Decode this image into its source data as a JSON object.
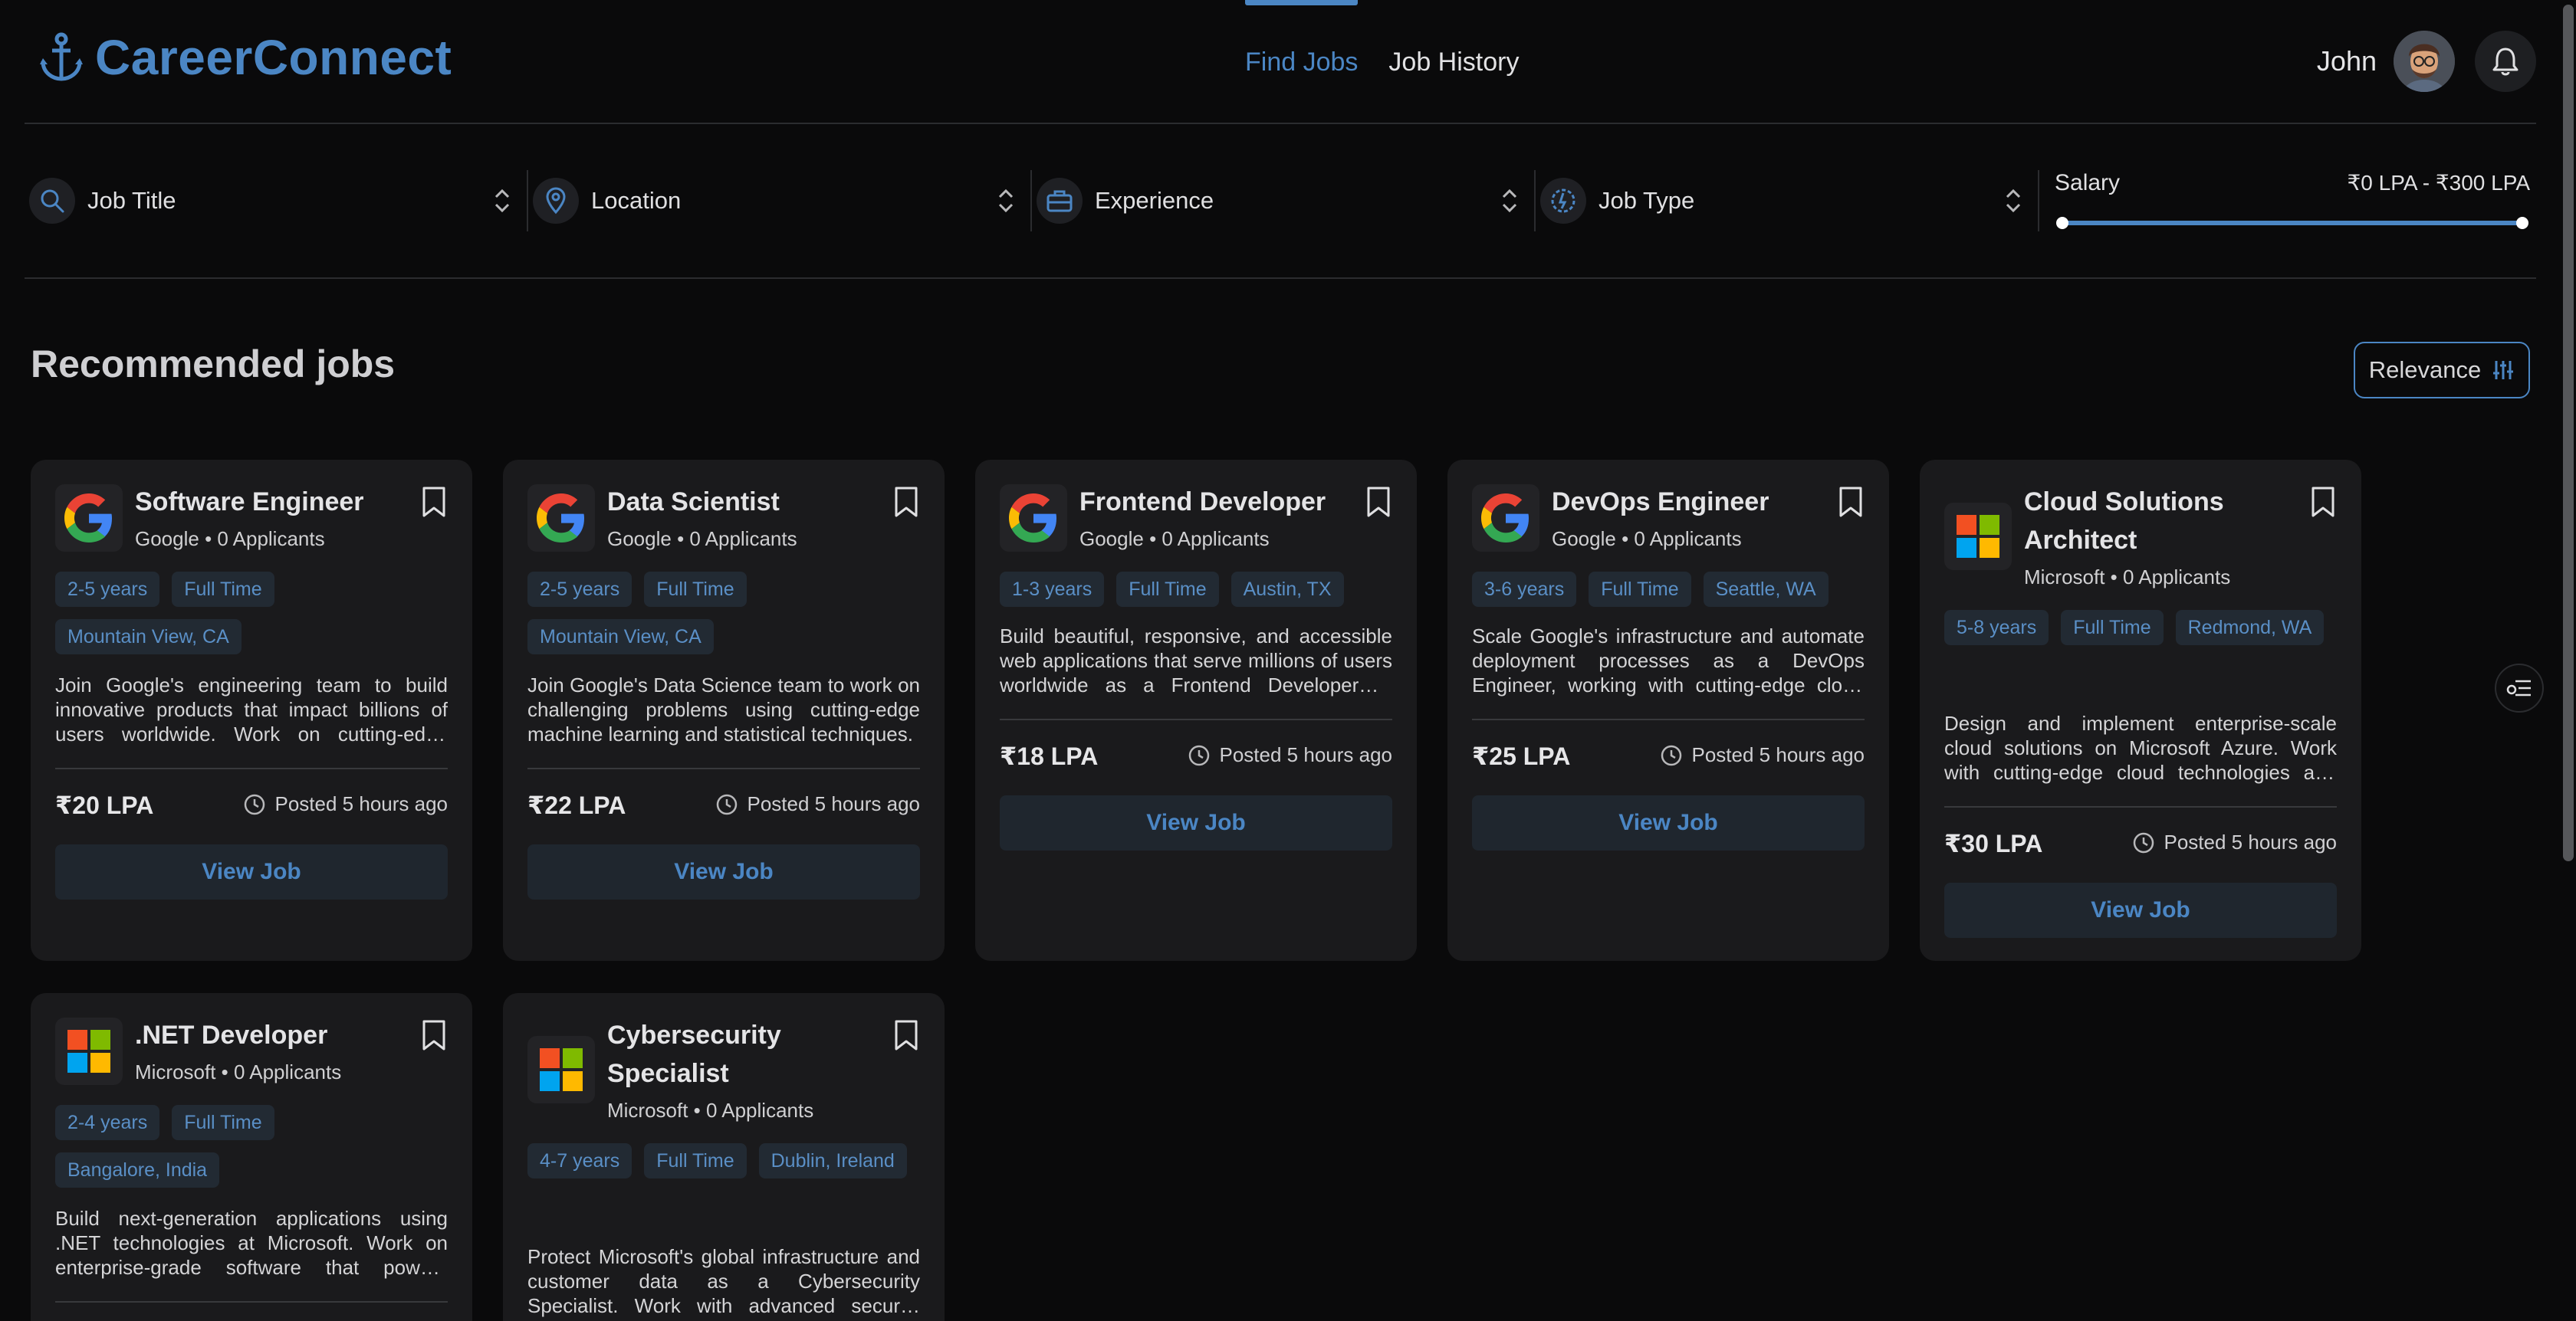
{
  "header": {
    "brand": "CareerConnect",
    "nav": [
      {
        "label": "Find Jobs",
        "active": true
      },
      {
        "label": "Job History",
        "active": false
      }
    ],
    "user_name": "John"
  },
  "filters": {
    "job_title": "Job Title",
    "location": "Location",
    "experience": "Experience",
    "job_type": "Job Type",
    "salary_label": "Salary",
    "salary_range": "₹0 LPA - ₹300 LPA"
  },
  "section": {
    "title": "Recommended jobs",
    "sort_label": "Relevance"
  },
  "jobs": [
    {
      "title": "Software Engineer",
      "company_line": "Google • 0 Applicants",
      "logo": "google-logo",
      "tags": [
        "2-5 years",
        "Full Time",
        "Mountain View, CA"
      ],
      "description": "Join Google's engineering team to build innovative products that impact billions of users worldwide. Work on cutting-edge technologies and scalable systems.",
      "salary": "₹20 LPA",
      "posted": "Posted 5 hours ago",
      "button": "View Job"
    },
    {
      "title": "Data Scientist",
      "company_line": "Google • 0 Applicants",
      "logo": "google-logo",
      "tags": [
        "2-5 years",
        "Full Time",
        "Mountain View, CA"
      ],
      "description": "Join Google's Data Science team to work on challenging problems using cutting-edge machine learning and statistical techniques.",
      "salary": "₹22 LPA",
      "posted": "Posted 5 hours ago",
      "button": "View Job"
    },
    {
      "title": "Frontend Developer",
      "company_line": "Google • 0 Applicants",
      "logo": "google-logo",
      "tags": [
        "1-3 years",
        "Full Time",
        "Austin, TX"
      ],
      "description": "Build beautiful, responsive, and accessible web applications that serve millions of users worldwide as a Frontend Developer at Google.",
      "salary": "₹18 LPA",
      "posted": "Posted 5 hours ago",
      "button": "View Job"
    },
    {
      "title": "DevOps Engineer",
      "company_line": "Google • 0 Applicants",
      "logo": "google-logo",
      "tags": [
        "3-6 years",
        "Full Time",
        "Seattle, WA"
      ],
      "description": "Scale Google's infrastructure and automate deployment processes as a DevOps Engineer, working with cutting-edge cloud technologies.",
      "salary": "₹25 LPA",
      "posted": "Posted 5 hours ago",
      "button": "View Job"
    },
    {
      "title": "Cloud Solutions Architect",
      "company_line": "Microsoft • 0 Applicants",
      "logo": "microsoft-logo",
      "tags": [
        "5-8 years",
        "Full Time",
        "Redmond, WA"
      ],
      "description": "Design and implement enterprise-scale cloud solutions on Microsoft Azure. Work with cutting-edge cloud technologies and enterprise clients.",
      "salary": "₹30 LPA",
      "posted": "Posted 5 hours ago",
      "button": "View Job"
    },
    {
      "title": ".NET Developer",
      "company_line": "Microsoft • 0 Applicants",
      "logo": "microsoft-logo",
      "tags": [
        "2-4 years",
        "Full Time",
        "Bangalore, India"
      ],
      "description": "Build next-generation applications using .NET technologies at Microsoft. Work on enterprise-grade software that powers businesses worldwide.",
      "salary": "",
      "posted": "",
      "button": ""
    },
    {
      "title": "Cybersecurity Specialist",
      "company_line": "Microsoft • 0 Applicants",
      "logo": "microsoft-logo",
      "tags": [
        "4-7 years",
        "Full Time",
        "Dublin, Ireland"
      ],
      "description": "Protect Microsoft's global infrastructure and customer data as a Cybersecurity Specialist. Work with advanced security technologies.",
      "salary": "",
      "posted": "",
      "button": ""
    }
  ],
  "colors": {
    "accent": "#4b86c4",
    "background": "#0a0a0b",
    "card": "#1a1a1c",
    "tag_bg": "#222a33"
  }
}
